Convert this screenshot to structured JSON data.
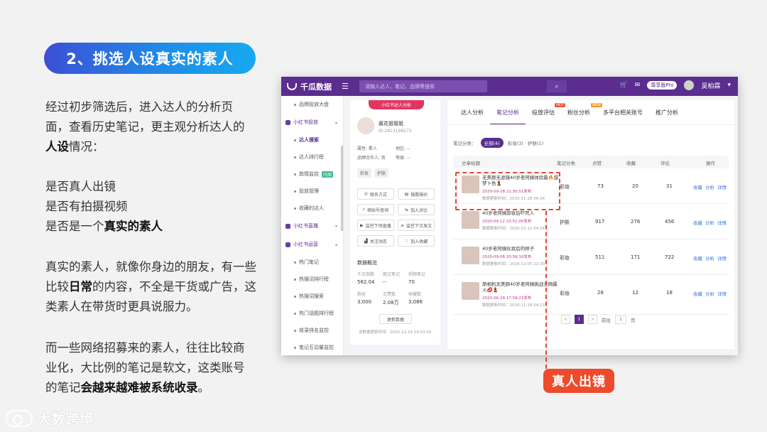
{
  "slide": {
    "title": "2、挑选人设真实的素人",
    "p1_a": "经过初步筛选后，进入达人的分析页面，查看历史笔记，更主观分析达人的",
    "p1_b": "人设",
    "p1_c": "情况：",
    "p2_l1": "是否真人出镜",
    "p2_l2": "是否有拍摄视频",
    "p2_l3a": "是否是一个",
    "p2_l3b": "真实的素人",
    "p3_a": "真实的素人，就像你身边的朋友，有一些比较",
    "p3_b": "日常",
    "p3_c": "的内容，不全是干货或广告，这类素人在带货时更具说服力。",
    "p4_a": "而一些网络招募来的素人，往往比较商业化，大比例的笔记是软文，这类账号的笔记",
    "p4_b": "会越来越难被系统收录",
    "p4_c": "。",
    "callout": "真人出镜",
    "logo_text": "大数跨境"
  },
  "app": {
    "brand": "千瓜数据",
    "search_placeholder": "请输入达人、笔记、品牌等搜索",
    "plan": "尊享版Pro",
    "user": "吴柏霖",
    "sidebar": {
      "item0": "品牌投放大盘",
      "group1": "小红书投放",
      "item1": "达人搜索",
      "item2": "达人排行榜",
      "item3": "舆情监控",
      "item3_tag": "内测",
      "item4": "投放管理",
      "item5": "收藏的达人",
      "group2": "小红书直播",
      "group3": "小红书运营",
      "item6": "热门笔记",
      "item7": "热搜词排行榜",
      "item8": "热搜词搜索",
      "item9": "热门话题排行榜",
      "item10": "收录排名监控",
      "item11": "笔记互动量监控"
    },
    "profile": {
      "tag": "小红书达人分析",
      "name": "酱花姐姐姐",
      "id": "ID:2813198273",
      "attr": "属性: 素人",
      "region": "地区: --",
      "brand": "品牌合作人: 否",
      "level": "等级: --",
      "chip1": "彩妆",
      "chip2": "护肤",
      "btn1": "联系方式",
      "btn2": "报数报价",
      "btn3": "相似号查询",
      "btn4": "加入对比",
      "btn5": "监控下场直播",
      "btn6": "监控下次发文",
      "btn7": "关注动态",
      "btn8": "加入收藏",
      "overview_title": "数据概览",
      "l1": "千瓜指数",
      "l2": "图文笔记",
      "l3": "视频笔记",
      "v1": "562.04",
      "v2": "--",
      "v3": "70",
      "l4": "粉丝",
      "l5": "点赞数",
      "l6": "收藏数",
      "v4": "3,000",
      "v5": "2.08万",
      "v6": "3,086",
      "update_btn": "更新数据",
      "update_time": "该数据更新时间：2020-12-24 03:43:59"
    },
    "tabs": {
      "t1": "达人分析",
      "t2": "笔记分析",
      "t3": "投放评估",
      "t3_tag": "HOT",
      "t4": "粉丝分析",
      "t4_tag": "NEW",
      "t5": "多平台相关账号",
      "t6": "推广分析"
    },
    "cats": {
      "label": "笔记分类：",
      "all": "全部(4)",
      "c1": "彩妆(3)",
      "c2": "护肤(1)"
    },
    "thead": {
      "c1": "文章标题",
      "c2": "笔记分类",
      "c3": "点赞",
      "c4": "收藏",
      "c5": "评论",
      "c6": "操作"
    },
    "rows": [
      {
        "title": "无美颜无滤镜40岁老阿姨体验最🔥甜梦卜色💄",
        "pub": "2020-09-28 21:30:51发布",
        "upd": "数据更新时间：2020-11-28 00:34",
        "cat": "彩妆",
        "like": "73",
        "fav": "20",
        "cmt": "31"
      },
      {
        "title": "40岁老阿姨卸妆后吓死人",
        "pub": "2020-09-12 22:51:05发布",
        "upd": "数据更新时间：2020-12-12 04:28",
        "cat": "护肤",
        "like": "917",
        "fav": "276",
        "cmt": "456"
      },
      {
        "title": "40岁老阿姨化妆后的样子",
        "pub": "2020-09-06 20:56:16发布",
        "upd": "数据更新时间：2020-12-05 22:30",
        "cat": "彩妆",
        "like": "511",
        "fav": "171",
        "cmt": "722"
      },
      {
        "title": "原相机无美颜40岁老阿姨挑战全网最火💋💄",
        "pub": "2020-06-29 17:59:23发布",
        "upd": "数据更新时间：2020-11-28 04:13",
        "cat": "彩妆",
        "like": "28",
        "fav": "12",
        "cmt": "18"
      }
    ],
    "ops": {
      "fav": "收藏",
      "ana": "分析",
      "det": "详情"
    },
    "pager": {
      "prev": "<",
      "cur": "1",
      "next": ">",
      "goto": "前往",
      "page": "1",
      "unit": "页"
    }
  },
  "colors": {
    "brand_purple": "#5a2d8f",
    "accent_red": "#ee4a2c",
    "title_blue": "#2a6fe0"
  }
}
